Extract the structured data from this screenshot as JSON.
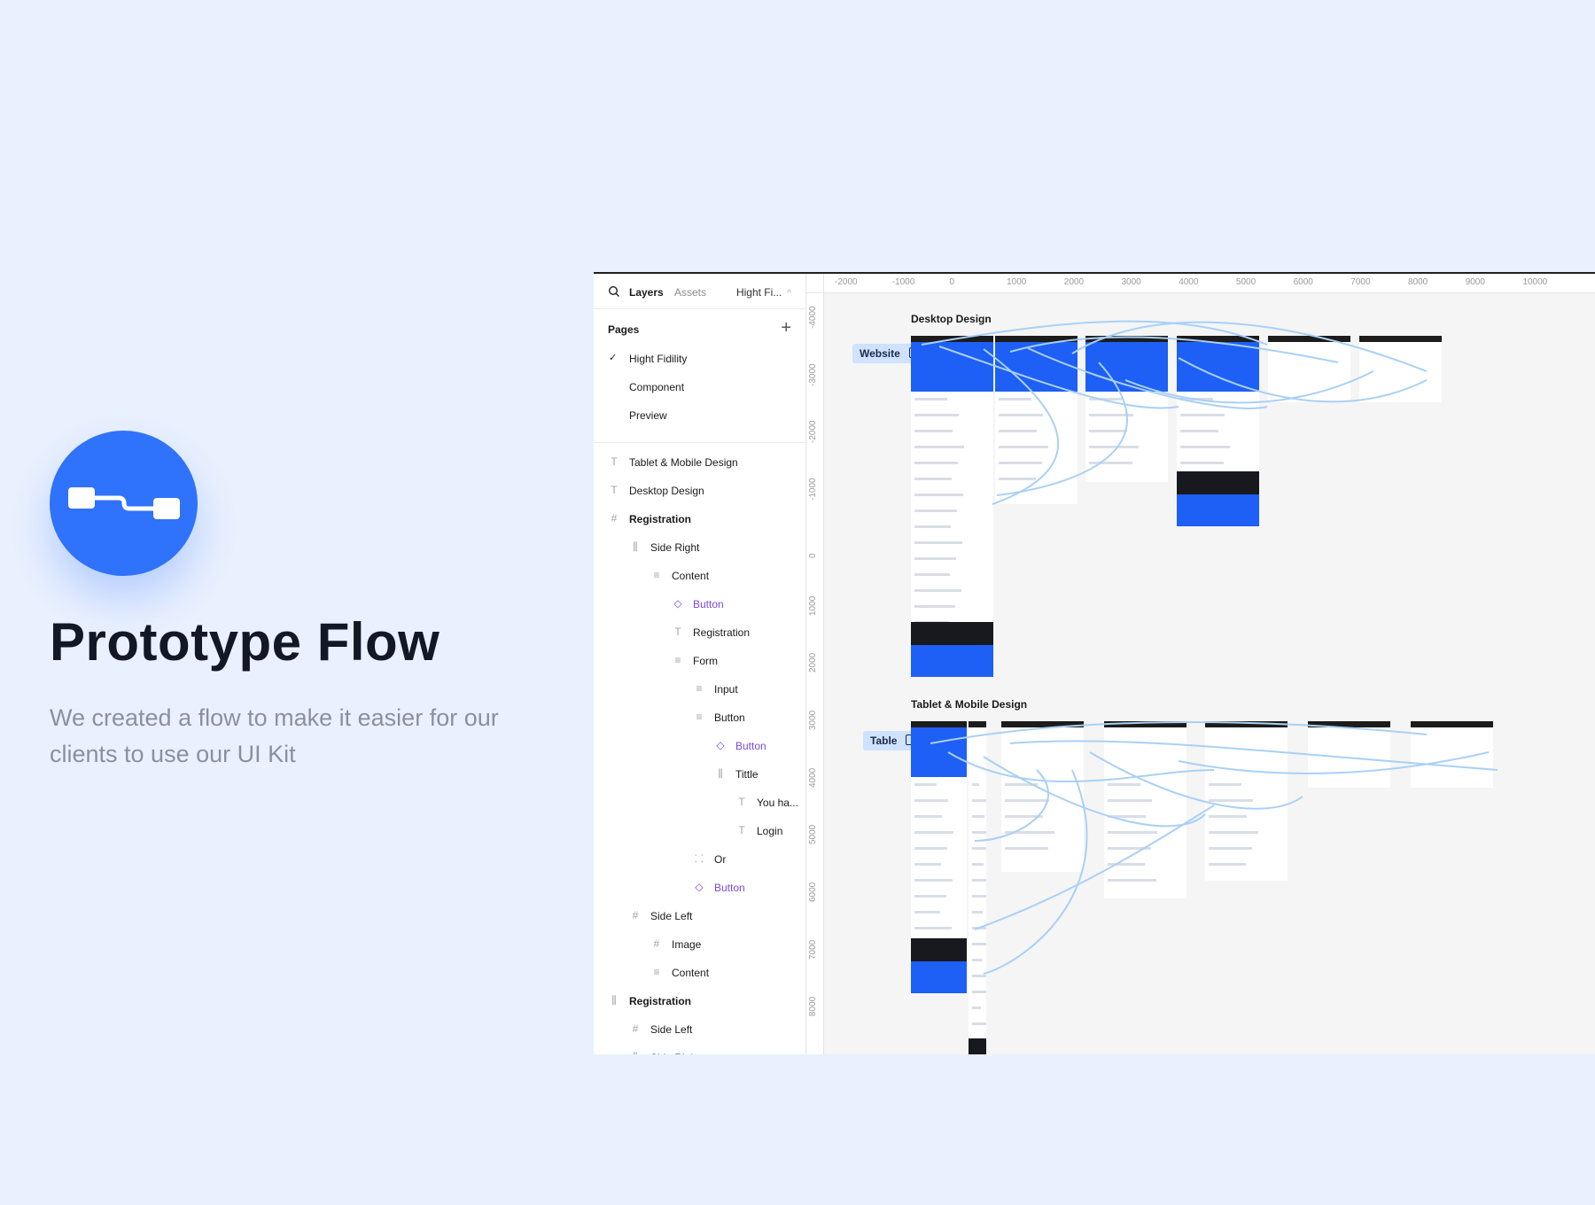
{
  "hero": {
    "title": "Prototype Flow",
    "description": "We created a flow to make it easier for our clients to use our UI Kit",
    "accent": "#2f72fb"
  },
  "sidebar": {
    "tabs": [
      "Layers",
      "Assets"
    ],
    "page_selector": "Hight Fi...",
    "pages_label": "Pages",
    "pages": [
      {
        "label": "Hight Fidility",
        "active": true
      },
      {
        "label": "Component",
        "active": false
      },
      {
        "label": "Preview",
        "active": false
      }
    ],
    "layers": [
      {
        "label": "Tablet & Mobile Design",
        "icon": "text"
      },
      {
        "label": "Desktop Design",
        "icon": "text"
      },
      {
        "label": "Registration",
        "icon": "frame"
      },
      {
        "label": "Side Right",
        "icon": "autolayout-h"
      },
      {
        "label": "Content",
        "icon": "autolayout-v"
      },
      {
        "label": "Button",
        "icon": "component"
      },
      {
        "label": "Registration",
        "icon": "text"
      },
      {
        "label": "Form",
        "icon": "autolayout-v"
      },
      {
        "label": "Input",
        "icon": "autolayout-v"
      },
      {
        "label": "Button",
        "icon": "autolayout-v"
      },
      {
        "label": "Button",
        "icon": "component"
      },
      {
        "label": "Tittle",
        "icon": "autolayout-h"
      },
      {
        "label": "You ha...",
        "icon": "text"
      },
      {
        "label": "Login",
        "icon": "text"
      },
      {
        "label": "Or",
        "icon": "group"
      },
      {
        "label": "Button",
        "icon": "component"
      },
      {
        "label": "Side Left",
        "icon": "frame"
      },
      {
        "label": "Image",
        "icon": "frame"
      },
      {
        "label": "Content",
        "icon": "autolayout-v"
      },
      {
        "label": "Registration",
        "icon": "autolayout-h"
      },
      {
        "label": "Side Left",
        "icon": "frame"
      },
      {
        "label": "Side Right",
        "icon": "autolayout-h"
      }
    ]
  },
  "canvas": {
    "ruler_x": [
      "-2000",
      "-1000",
      "0",
      "1000",
      "2000",
      "3000",
      "4000",
      "5000",
      "6000",
      "7000",
      "8000",
      "9000",
      "10000"
    ],
    "ruler_y": [
      "-4000",
      "-3000",
      "-2000",
      "-1000",
      "0",
      "1000",
      "2000",
      "3000",
      "4000",
      "5000",
      "6000",
      "7000",
      "8000"
    ],
    "sections": [
      {
        "title": "Desktop Design",
        "flow_label": "Website"
      },
      {
        "title": "Tablet & Mobile Design",
        "flow_label": "Table"
      }
    ],
    "accent_blue": "#1e5ff5",
    "flow_line_color": "#a9d0f7"
  }
}
